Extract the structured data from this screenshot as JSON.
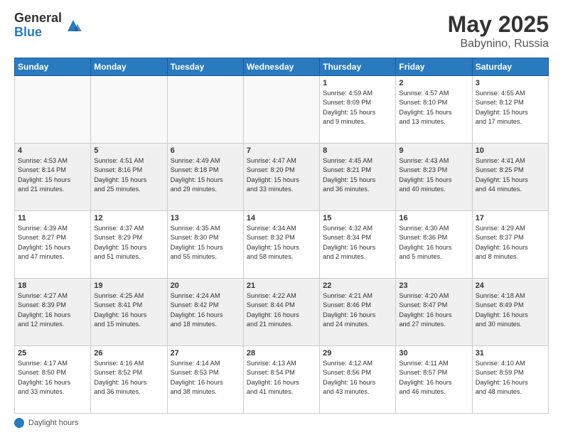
{
  "logo": {
    "general": "General",
    "blue": "Blue"
  },
  "title": {
    "month_year": "May 2025",
    "location": "Babynino, Russia"
  },
  "weekdays": [
    "Sunday",
    "Monday",
    "Tuesday",
    "Wednesday",
    "Thursday",
    "Friday",
    "Saturday"
  ],
  "footer": {
    "label": "Daylight hours"
  },
  "weeks": [
    [
      {
        "day": "",
        "info": ""
      },
      {
        "day": "",
        "info": ""
      },
      {
        "day": "",
        "info": ""
      },
      {
        "day": "",
        "info": ""
      },
      {
        "day": "1",
        "info": "Sunrise: 4:59 AM\nSunset: 8:09 PM\nDaylight: 15 hours\nand 9 minutes."
      },
      {
        "day": "2",
        "info": "Sunrise: 4:57 AM\nSunset: 8:10 PM\nDaylight: 15 hours\nand 13 minutes."
      },
      {
        "day": "3",
        "info": "Sunrise: 4:55 AM\nSunset: 8:12 PM\nDaylight: 15 hours\nand 17 minutes."
      }
    ],
    [
      {
        "day": "4",
        "info": "Sunrise: 4:53 AM\nSunset: 8:14 PM\nDaylight: 15 hours\nand 21 minutes."
      },
      {
        "day": "5",
        "info": "Sunrise: 4:51 AM\nSunset: 8:16 PM\nDaylight: 15 hours\nand 25 minutes."
      },
      {
        "day": "6",
        "info": "Sunrise: 4:49 AM\nSunset: 8:18 PM\nDaylight: 15 hours\nand 29 minutes."
      },
      {
        "day": "7",
        "info": "Sunrise: 4:47 AM\nSunset: 8:20 PM\nDaylight: 15 hours\nand 33 minutes."
      },
      {
        "day": "8",
        "info": "Sunrise: 4:45 AM\nSunset: 8:21 PM\nDaylight: 15 hours\nand 36 minutes."
      },
      {
        "day": "9",
        "info": "Sunrise: 4:43 AM\nSunset: 8:23 PM\nDaylight: 15 hours\nand 40 minutes."
      },
      {
        "day": "10",
        "info": "Sunrise: 4:41 AM\nSunset: 8:25 PM\nDaylight: 15 hours\nand 44 minutes."
      }
    ],
    [
      {
        "day": "11",
        "info": "Sunrise: 4:39 AM\nSunset: 8:27 PM\nDaylight: 15 hours\nand 47 minutes."
      },
      {
        "day": "12",
        "info": "Sunrise: 4:37 AM\nSunset: 8:29 PM\nDaylight: 15 hours\nand 51 minutes."
      },
      {
        "day": "13",
        "info": "Sunrise: 4:35 AM\nSunset: 8:30 PM\nDaylight: 15 hours\nand 55 minutes."
      },
      {
        "day": "14",
        "info": "Sunrise: 4:34 AM\nSunset: 8:32 PM\nDaylight: 15 hours\nand 58 minutes."
      },
      {
        "day": "15",
        "info": "Sunrise: 4:32 AM\nSunset: 8:34 PM\nDaylight: 16 hours\nand 2 minutes."
      },
      {
        "day": "16",
        "info": "Sunrise: 4:30 AM\nSunset: 8:36 PM\nDaylight: 16 hours\nand 5 minutes."
      },
      {
        "day": "17",
        "info": "Sunrise: 4:29 AM\nSunset: 8:37 PM\nDaylight: 16 hours\nand 8 minutes."
      }
    ],
    [
      {
        "day": "18",
        "info": "Sunrise: 4:27 AM\nSunset: 8:39 PM\nDaylight: 16 hours\nand 12 minutes."
      },
      {
        "day": "19",
        "info": "Sunrise: 4:25 AM\nSunset: 8:41 PM\nDaylight: 16 hours\nand 15 minutes."
      },
      {
        "day": "20",
        "info": "Sunrise: 4:24 AM\nSunset: 8:42 PM\nDaylight: 16 hours\nand 18 minutes."
      },
      {
        "day": "21",
        "info": "Sunrise: 4:22 AM\nSunset: 8:44 PM\nDaylight: 16 hours\nand 21 minutes."
      },
      {
        "day": "22",
        "info": "Sunrise: 4:21 AM\nSunset: 8:46 PM\nDaylight: 16 hours\nand 24 minutes."
      },
      {
        "day": "23",
        "info": "Sunrise: 4:20 AM\nSunset: 8:47 PM\nDaylight: 16 hours\nand 27 minutes."
      },
      {
        "day": "24",
        "info": "Sunrise: 4:18 AM\nSunset: 8:49 PM\nDaylight: 16 hours\nand 30 minutes."
      }
    ],
    [
      {
        "day": "25",
        "info": "Sunrise: 4:17 AM\nSunset: 8:50 PM\nDaylight: 16 hours\nand 33 minutes."
      },
      {
        "day": "26",
        "info": "Sunrise: 4:16 AM\nSunset: 8:52 PM\nDaylight: 16 hours\nand 36 minutes."
      },
      {
        "day": "27",
        "info": "Sunrise: 4:14 AM\nSunset: 8:53 PM\nDaylight: 16 hours\nand 38 minutes."
      },
      {
        "day": "28",
        "info": "Sunrise: 4:13 AM\nSunset: 8:54 PM\nDaylight: 16 hours\nand 41 minutes."
      },
      {
        "day": "29",
        "info": "Sunrise: 4:12 AM\nSunset: 8:56 PM\nDaylight: 16 hours\nand 43 minutes."
      },
      {
        "day": "30",
        "info": "Sunrise: 4:11 AM\nSunset: 8:57 PM\nDaylight: 16 hours\nand 46 minutes."
      },
      {
        "day": "31",
        "info": "Sunrise: 4:10 AM\nSunset: 8:59 PM\nDaylight: 16 hours\nand 48 minutes."
      }
    ]
  ]
}
